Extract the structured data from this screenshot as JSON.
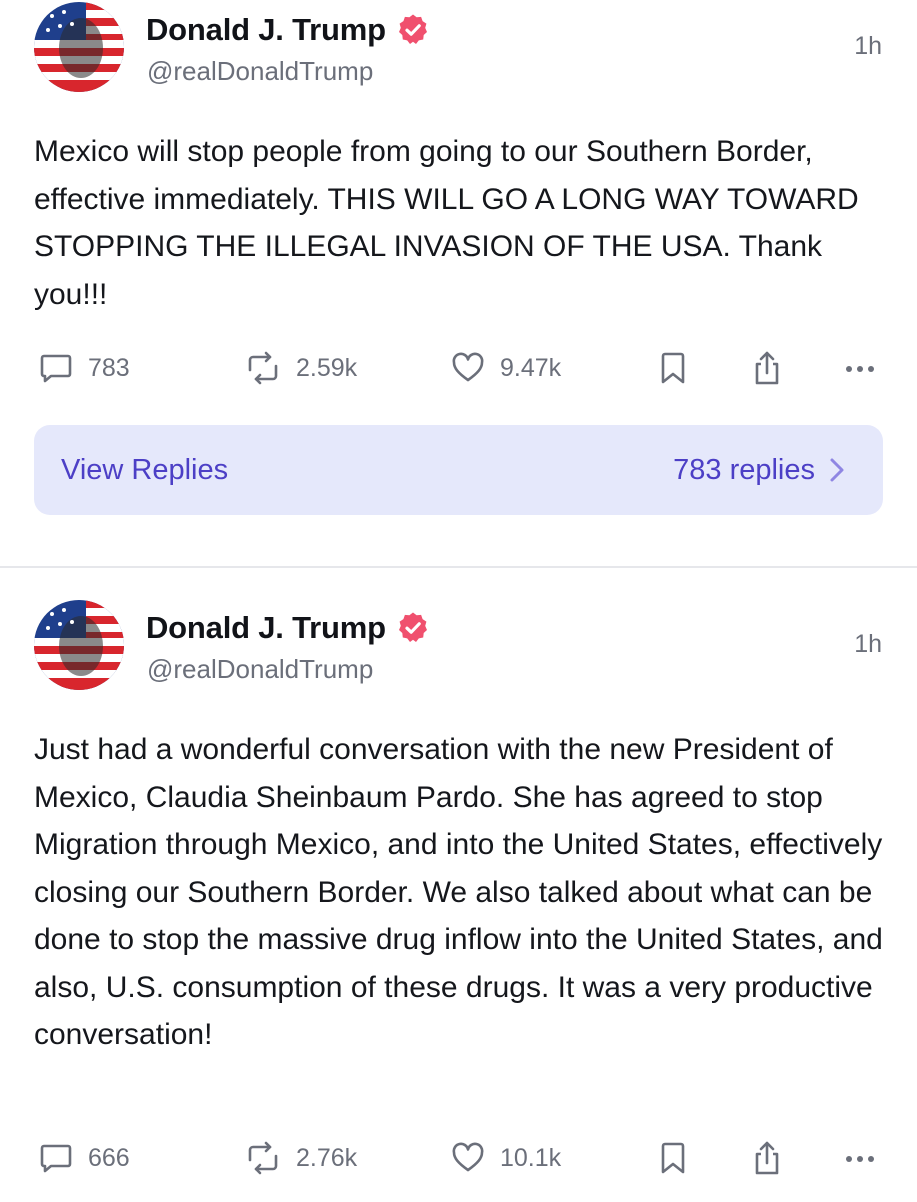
{
  "colors": {
    "accent": "#4c3fc6",
    "accent_bg": "#e5e8fb",
    "verified": "#f0506e",
    "muted": "#6b6f7a"
  },
  "posts": [
    {
      "author": "Donald J. Trump",
      "handle": "@realDonaldTrump",
      "time": "1h",
      "verified_icon": "verified-badge-icon",
      "text": "Mexico will stop people from going to our Southern Border, effective immediately. THIS WILL GO A LONG WAY TOWARD STOPPING THE ILLEGAL INVASION OF THE USA. Thank you!!!",
      "reply_count": "783",
      "repost_count": "2.59k",
      "like_count": "9.47k",
      "view_replies_label": "View Replies",
      "replies_summary": "783 replies"
    },
    {
      "author": "Donald J. Trump",
      "handle": "@realDonaldTrump",
      "time": "1h",
      "verified_icon": "verified-badge-icon",
      "text": "Just had a wonderful conversation with the new President of Mexico, Claudia Sheinbaum Pardo. She has agreed to stop Migration through Mexico, and into the United States, effectively closing our Southern Border. We also talked about what can be done to stop the massive drug inflow into the United States, and also, U.S. consumption of these drugs. It was a very productive conversation!",
      "reply_count": "666",
      "repost_count": "2.76k",
      "like_count": "10.1k"
    }
  ]
}
